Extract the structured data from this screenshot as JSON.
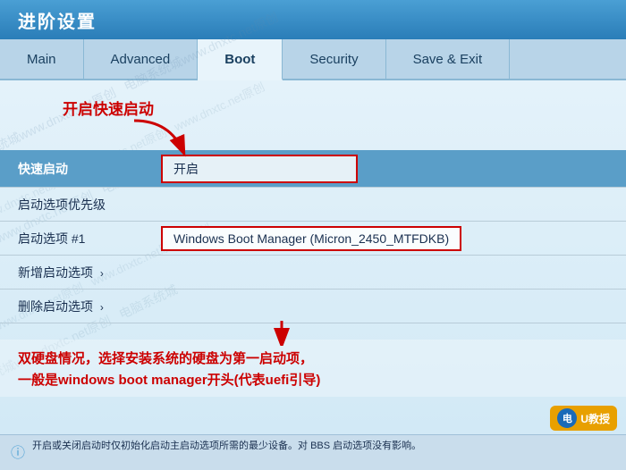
{
  "window": {
    "title": "进阶设置"
  },
  "tabs": [
    {
      "label": "Main",
      "active": false
    },
    {
      "label": "Advanced",
      "active": false
    },
    {
      "label": "Boot",
      "active": true
    },
    {
      "label": "Security",
      "active": false
    },
    {
      "label": "Save & Exit",
      "active": false
    }
  ],
  "annotation_top": "开启快速启动",
  "settings": [
    {
      "label": "快速启动",
      "value": "开启",
      "highlighted": true,
      "has_box": true
    },
    {
      "label": "启动选项优先级",
      "value": "",
      "highlighted": false,
      "has_box": false
    },
    {
      "label": "启动选项 #1",
      "value": "Windows Boot Manager (Micron_2450_MTFDKB)",
      "highlighted": false,
      "has_box": true
    },
    {
      "label": "新增启动选项",
      "value": "",
      "highlighted": false,
      "has_box": false,
      "chevron": true
    },
    {
      "label": "删除启动选项",
      "value": "",
      "highlighted": false,
      "has_box": false,
      "chevron": true
    }
  ],
  "annotation_bottom_line1": "双硬盘情况，选择安装系统的硬盘为第一启动项，",
  "annotation_bottom_line2": "一般是windows boot manager开头(代表uefi引导)",
  "status_text": "开启或关闭启动时仅初始化启动主启动选项所需的最少设备。对 BBS 启动选项没有影响。",
  "logo": {
    "icon": "电",
    "text": "U教授"
  },
  "watermarks": [
    "www.dnxtc.net原创",
    "电脑系统城www.dnxtc.net原创",
    "www.dnxtc.net原创"
  ]
}
